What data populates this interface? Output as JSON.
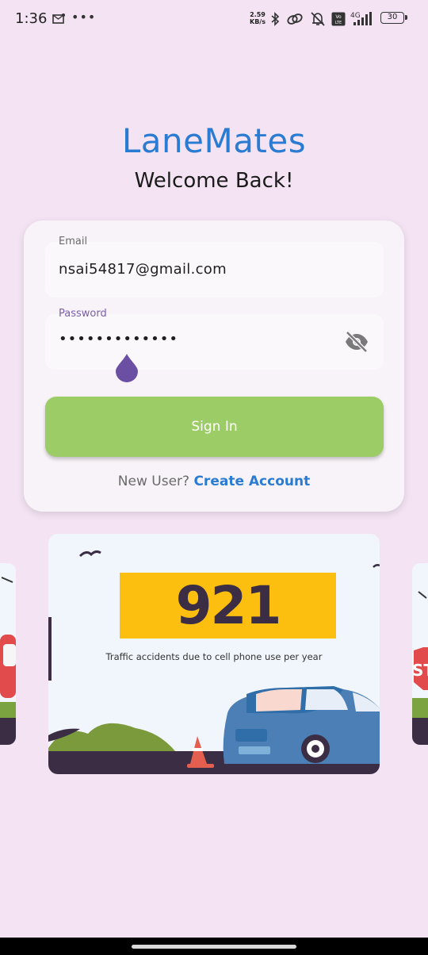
{
  "status_bar": {
    "time": "1:36",
    "net_speed_value": "2.59",
    "net_speed_unit": "KB/s",
    "network_type": "4G",
    "battery": "30",
    "icons": [
      "mail-icon",
      "more-icon",
      "bluetooth-icon",
      "link-icon",
      "mute-icon",
      "volte-icon",
      "signal-icon",
      "battery-icon"
    ]
  },
  "header": {
    "app_title": "LaneMates",
    "welcome": "Welcome Back!"
  },
  "login": {
    "email_label": "Email",
    "email_value": "nsai54817@gmail.com",
    "password_label": "Password",
    "password_value": "•••••••••••••",
    "signin_label": "Sign In",
    "new_user_text": "New User?",
    "create_account_label": "Create Account"
  },
  "carousel": {
    "stat_number": "921",
    "stat_caption": "Traffic accidents due to cell phone use per year",
    "side_right_sign": "ST"
  },
  "colors": {
    "background": "#f3e3f3",
    "brand_blue": "#2a7bd2",
    "signin_green": "#9ccc65",
    "stat_yellow": "#fdbf0f",
    "focus_purple": "#6a4fa3"
  }
}
